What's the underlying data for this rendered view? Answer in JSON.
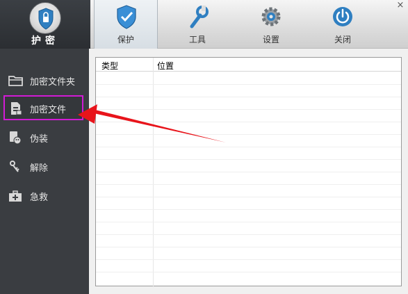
{
  "app": {
    "logo_text": "护密",
    "close_glyph": "×"
  },
  "tabs": [
    {
      "label": "保护",
      "icon": "shield-icon",
      "active": true
    },
    {
      "label": "工具",
      "icon": "wrench-icon",
      "active": false
    },
    {
      "label": "设置",
      "icon": "gear-icon",
      "active": false
    },
    {
      "label": "关闭",
      "icon": "power-icon",
      "active": false
    }
  ],
  "sidebar": {
    "items": [
      {
        "label": "加密文件夹",
        "icon": "folder-icon"
      },
      {
        "label": "加密文件",
        "icon": "lock-file-icon",
        "selected": true
      },
      {
        "label": "伪装",
        "icon": "mask-icon"
      },
      {
        "label": "解除",
        "icon": "key-icon"
      },
      {
        "label": "急救",
        "icon": "first-aid-kit-icon"
      }
    ]
  },
  "table": {
    "columns": [
      "类型",
      "位置"
    ],
    "rows": []
  },
  "colors": {
    "highlight_border": "#d21bd6",
    "arrow": "#e8141b",
    "sidebar_bg": "#3a3d41"
  }
}
